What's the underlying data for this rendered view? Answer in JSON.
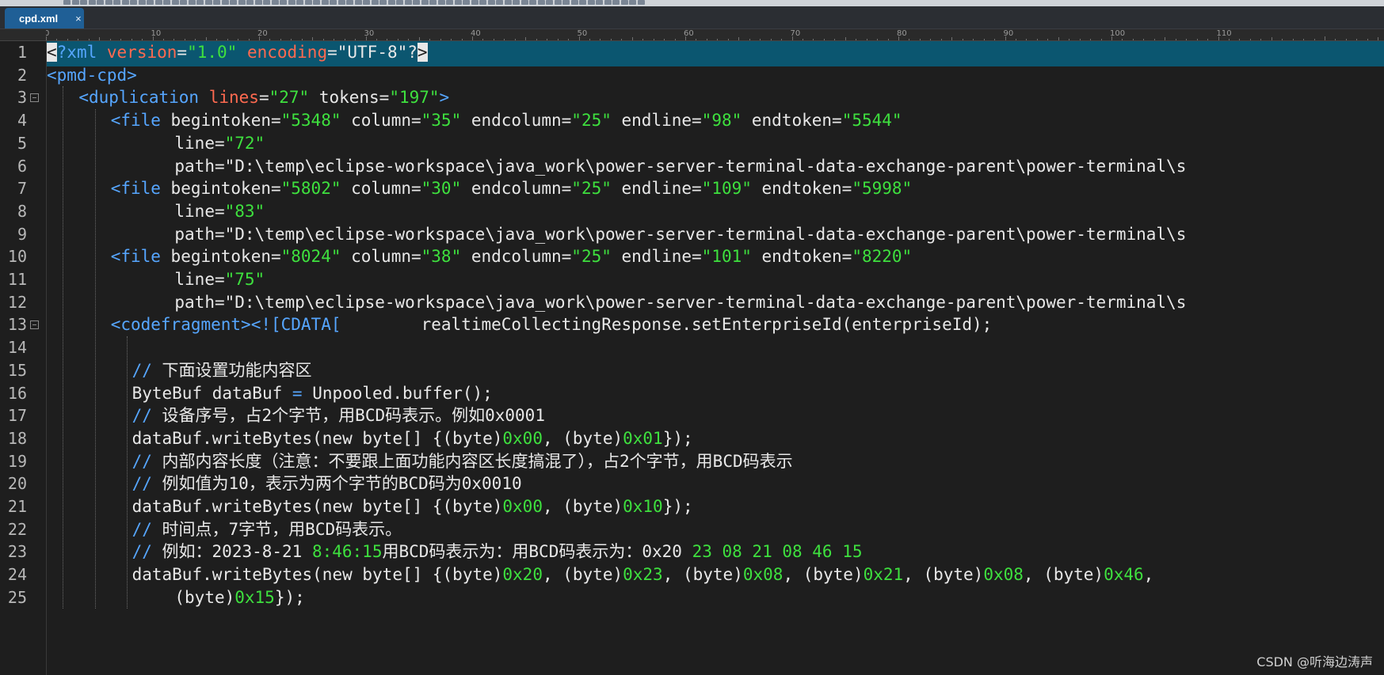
{
  "tab": {
    "title": "cpd.xml",
    "close": "×"
  },
  "ruler": {
    "labels": [
      "0",
      "10",
      "20",
      "30",
      "40",
      "50",
      "60",
      "70",
      "80",
      "90",
      "100",
      "110"
    ]
  },
  "lines": [
    {
      "n": "1",
      "fold": false,
      "indent": 0,
      "tokens": [
        [
          "sel",
          "<"
        ],
        [
          "tg",
          "?xml"
        ],
        [
          "pl",
          " "
        ],
        [
          "at",
          "version"
        ],
        [
          "pl",
          "="
        ],
        [
          "vl",
          "\"1.0\""
        ],
        [
          "pl",
          " "
        ],
        [
          "at",
          "encoding"
        ],
        [
          "pl",
          "="
        ],
        [
          "pl",
          "\"UTF-8\""
        ],
        [
          "pl",
          "?"
        ],
        [
          "sel",
          ">"
        ]
      ]
    },
    {
      "n": "2",
      "fold": false,
      "indent": 0,
      "tokens": [
        [
          "tg",
          "<pmd-cpd>"
        ]
      ]
    },
    {
      "n": "3",
      "fold": true,
      "indent": 3,
      "tokens": [
        [
          "tg",
          "<duplication"
        ],
        [
          "pl",
          " "
        ],
        [
          "at",
          "lines"
        ],
        [
          "pl",
          "="
        ],
        [
          "vl",
          "\"27\""
        ],
        [
          "pl",
          " tokens="
        ],
        [
          "vl",
          "\"197\""
        ],
        [
          "tg",
          ">"
        ]
      ]
    },
    {
      "n": "4",
      "fold": false,
      "indent": 6,
      "tokens": [
        [
          "tg",
          "<file"
        ],
        [
          "pl",
          " begintoken="
        ],
        [
          "vl",
          "\"5348\""
        ],
        [
          "pl",
          " column="
        ],
        [
          "vl",
          "\"35\""
        ],
        [
          "pl",
          " endcolumn="
        ],
        [
          "vl",
          "\"25\""
        ],
        [
          "pl",
          " endline="
        ],
        [
          "vl",
          "\"98\""
        ],
        [
          "pl",
          " endtoken="
        ],
        [
          "vl",
          "\"5544\""
        ]
      ]
    },
    {
      "n": "5",
      "fold": false,
      "indent": 12,
      "tokens": [
        [
          "pl",
          "line="
        ],
        [
          "vl",
          "\"72\""
        ]
      ]
    },
    {
      "n": "6",
      "fold": false,
      "indent": 12,
      "tokens": [
        [
          "pl",
          "path=\"D:\\temp\\eclipse-workspace\\java_work\\power-server-terminal-data-exchange-parent\\power-terminal\\s"
        ]
      ]
    },
    {
      "n": "7",
      "fold": false,
      "indent": 6,
      "tokens": [
        [
          "tg",
          "<file"
        ],
        [
          "pl",
          " begintoken="
        ],
        [
          "vl",
          "\"5802\""
        ],
        [
          "pl",
          " column="
        ],
        [
          "vl",
          "\"30\""
        ],
        [
          "pl",
          " endcolumn="
        ],
        [
          "vl",
          "\"25\""
        ],
        [
          "pl",
          " endline="
        ],
        [
          "vl",
          "\"109\""
        ],
        [
          "pl",
          " endtoken="
        ],
        [
          "vl",
          "\"5998\""
        ]
      ]
    },
    {
      "n": "8",
      "fold": false,
      "indent": 12,
      "tokens": [
        [
          "pl",
          "line="
        ],
        [
          "vl",
          "\"83\""
        ]
      ]
    },
    {
      "n": "9",
      "fold": false,
      "indent": 12,
      "tokens": [
        [
          "pl",
          "path=\"D:\\temp\\eclipse-workspace\\java_work\\power-server-terminal-data-exchange-parent\\power-terminal\\s"
        ]
      ]
    },
    {
      "n": "10",
      "fold": false,
      "indent": 6,
      "tokens": [
        [
          "tg",
          "<file"
        ],
        [
          "pl",
          " begintoken="
        ],
        [
          "vl",
          "\"8024\""
        ],
        [
          "pl",
          " column="
        ],
        [
          "vl",
          "\"38\""
        ],
        [
          "pl",
          " endcolumn="
        ],
        [
          "vl",
          "\"25\""
        ],
        [
          "pl",
          " endline="
        ],
        [
          "vl",
          "\"101\""
        ],
        [
          "pl",
          " endtoken="
        ],
        [
          "vl",
          "\"8220\""
        ]
      ]
    },
    {
      "n": "11",
      "fold": false,
      "indent": 12,
      "tokens": [
        [
          "pl",
          "line="
        ],
        [
          "vl",
          "\"75\""
        ]
      ]
    },
    {
      "n": "12",
      "fold": false,
      "indent": 12,
      "tokens": [
        [
          "pl",
          "path=\"D:\\temp\\eclipse-workspace\\java_work\\power-server-terminal-data-exchange-parent\\power-terminal\\s"
        ]
      ]
    },
    {
      "n": "13",
      "fold": true,
      "indent": 6,
      "tokens": [
        [
          "tg",
          "<codefragment><![CDATA["
        ],
        [
          "ct",
          "        realtimeCollectingResponse.setEnterpriseId(enterpriseId);"
        ]
      ]
    },
    {
      "n": "14",
      "fold": false,
      "indent": 8,
      "tokens": []
    },
    {
      "n": "15",
      "fold": false,
      "indent": 8,
      "tokens": [
        [
          "cm",
          "// "
        ],
        [
          "ct",
          "下面设置功能内容区"
        ]
      ]
    },
    {
      "n": "16",
      "fold": false,
      "indent": 8,
      "tokens": [
        [
          "ct",
          "ByteBuf dataBuf "
        ],
        [
          "cm",
          "="
        ],
        [
          "ct",
          " Unpooled.buffer();"
        ]
      ]
    },
    {
      "n": "17",
      "fold": false,
      "indent": 8,
      "tokens": [
        [
          "cm",
          "// "
        ],
        [
          "ct",
          "设备序号，占2个字节，用BCD码表示。例如0x0001"
        ]
      ]
    },
    {
      "n": "18",
      "fold": false,
      "indent": 8,
      "tokens": [
        [
          "ct",
          "dataBuf.writeBytes(new byte[] {(byte)"
        ],
        [
          "nm",
          "0x00"
        ],
        [
          "ct",
          ", (byte)"
        ],
        [
          "nm",
          "0x01"
        ],
        [
          "ct",
          "});"
        ]
      ]
    },
    {
      "n": "19",
      "fold": false,
      "indent": 8,
      "tokens": [
        [
          "cm",
          "// "
        ],
        [
          "ct",
          "内部内容长度（注意：不要跟上面功能内容区长度搞混了），占2个字节，用BCD码表示"
        ]
      ]
    },
    {
      "n": "20",
      "fold": false,
      "indent": 8,
      "tokens": [
        [
          "cm",
          "// "
        ],
        [
          "ct",
          "例如值为10，表示为两个字节的BCD码为0x0010"
        ]
      ]
    },
    {
      "n": "21",
      "fold": false,
      "indent": 8,
      "tokens": [
        [
          "ct",
          "dataBuf.writeBytes(new byte[] {(byte)"
        ],
        [
          "nm",
          "0x00"
        ],
        [
          "ct",
          ", (byte)"
        ],
        [
          "nm",
          "0x10"
        ],
        [
          "ct",
          "});"
        ]
      ]
    },
    {
      "n": "22",
      "fold": false,
      "indent": 8,
      "tokens": [
        [
          "cm",
          "// "
        ],
        [
          "ct",
          "时间点，7字节，用BCD码表示。"
        ]
      ]
    },
    {
      "n": "23",
      "fold": false,
      "indent": 8,
      "tokens": [
        [
          "cm",
          "// "
        ],
        [
          "ct",
          "例如：2023-8-21 "
        ],
        [
          "nm",
          "8:46:15"
        ],
        [
          "ct",
          "用BCD码表示为：用BCD码表示为：0x20 "
        ],
        [
          "nm",
          "23 08 21 08 46 15"
        ]
      ]
    },
    {
      "n": "24",
      "fold": false,
      "indent": 8,
      "tokens": [
        [
          "ct",
          "dataBuf.writeBytes(new byte[] {(byte)"
        ],
        [
          "nm",
          "0x20"
        ],
        [
          "ct",
          ", (byte)"
        ],
        [
          "nm",
          "0x23"
        ],
        [
          "ct",
          ", (byte)"
        ],
        [
          "nm",
          "0x08"
        ],
        [
          "ct",
          ", (byte)"
        ],
        [
          "nm",
          "0x21"
        ],
        [
          "ct",
          ", (byte)"
        ],
        [
          "nm",
          "0x08"
        ],
        [
          "ct",
          ", (byte)"
        ],
        [
          "nm",
          "0x46"
        ],
        [
          "ct",
          ","
        ]
      ]
    },
    {
      "n": "25",
      "fold": false,
      "indent": 12,
      "tokens": [
        [
          "ct",
          "(byte)"
        ],
        [
          "nm",
          "0x15"
        ],
        [
          "ct",
          "});"
        ]
      ]
    }
  ],
  "watermark": "CSDN @听海边涛声"
}
